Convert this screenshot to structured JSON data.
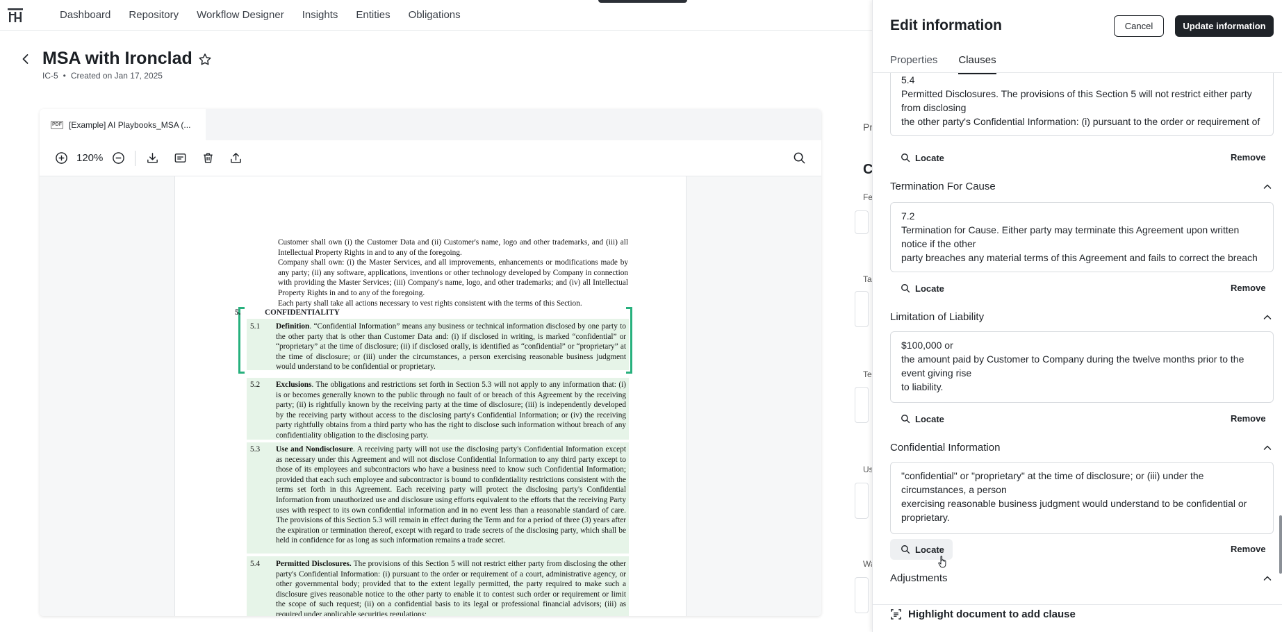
{
  "nav": {
    "items": [
      "Dashboard",
      "Repository",
      "Workflow Designer",
      "Insights",
      "Entities",
      "Obligations"
    ]
  },
  "document": {
    "title": "MSA with Ironclad",
    "id": "IC-5",
    "created": "Created on Jan 17, 2025",
    "tab_label": "[Example] AI Playbooks_MSA (...",
    "tab_badge": "PDF",
    "zoom": "120%"
  },
  "pdf": {
    "intro_lines": [
      "Customer shall own (i) the Customer Data and (ii) Customer's name, logo and other trademarks, and (iii) all Intellectual Property Rights in and to any of the foregoing.",
      "Company shall own: (i) the Master Services, and all improvements, enhancements or modifications made by any party; (ii) any software, applications, inventions or other technology developed by Company in connection with providing the Master Services; (iii) Company's name, logo, and other trademarks; and (iv) all Intellectual Property Rights in and to any of the foregoing.",
      "Each party shall take all actions necessary to vest rights consistent with the terms of this Section."
    ],
    "section_number": "5.",
    "section_title": "CONFIDENTIALITY",
    "clauses": [
      {
        "num": "5.1",
        "title": "Definition",
        "text": ". “Confidential Information” means any business or technical information disclosed by one party to the other party that is other than Customer Data and: (i) if disclosed in writing, is marked “confidential” or “proprietary” at the time of disclosure; (ii) if disclosed orally, is identified as “confidential” or “proprietary” at the time of disclosure; or (iii) under the circumstances, a person exercising reasonable business judgment would understand to be confidential or proprietary."
      },
      {
        "num": "5.2",
        "title": "Exclusions",
        "text": ".  The obligations and restrictions set forth in Section 5.3 will not apply to any information that: (i) is or becomes generally known to the public through no fault of or breach of this Agreement by the receiving party; (ii) is rightfully known by the receiving party at the time of disclosure; (iii) is independently developed by the receiving party without access to the disclosing party's Confidential Information; or (iv) the receiving party rightfully obtains from a third party who has the right to disclose such information without breach of any confidentiality obligation to the disclosing party."
      },
      {
        "num": "5.3",
        "title": "Use and Nondisclosure",
        "text": ".  A receiving party will not use the disclosing party's Confidential Information except as necessary under this Agreement and will not disclose Confidential Information to any third party except to those of its employees and subcontractors who have a business need to know such Confidential Information; provided that each such employee and subcontractor is bound to confidentiality restrictions consistent with the terms set forth in this Agreement.  Each receiving party will protect the disclosing party's Confidential Information from unauthorized use and disclosure using efforts equivalent to the efforts that the receiving Party uses with respect to its own confidential information and in no event less than a reasonable standard of care.  The provisions of this Section 5.3 will remain in effect during the Term and for a period of three (3) years after the expiration or termination thereof, except with regard to trade secrets of the disclosing party, which shall be held in confidence for as long as such information remains a trade secret."
      },
      {
        "num": "5.4",
        "title": "Permitted Disclosures.",
        "text": "  The provisions of this Section 5 will not restrict either party from disclosing the other party's Confidential Information: (i) pursuant to the order or requirement of a court, administrative agency, or other governmental body; provided that to the extent legally permitted, the party required to make such a disclosure gives reasonable notice to the other party to enable it to contest such order or requirement or limit the scope of such request; (ii) on a confidential basis to its legal or professional financial advisors; (iii) as required under applicable securities regulations;"
      }
    ]
  },
  "side_strip": {
    "letters": [
      "Pr",
      "C",
      "Fe",
      "Ta",
      "Te",
      "Us",
      "Wa"
    ]
  },
  "panel": {
    "title": "Edit information",
    "cancel": "Cancel",
    "update": "Update information",
    "tabs": [
      "Properties",
      "Clauses"
    ],
    "locate_label": "Locate",
    "remove_label": "Remove",
    "clauses": [
      {
        "name": "",
        "lines": [
          "5.4",
          "Permitted Disclosures. The provisions of this Section 5 will not restrict either party from disclosing",
          "the other party's Confidential Information: (i) pursuant to the order or requirement of"
        ]
      },
      {
        "name": "Termination For Cause",
        "lines": [
          "7.2",
          "Termination for Cause. Either party may terminate this Agreement upon written notice if the other",
          "party breaches any material terms of this Agreement and fails to correct the breach"
        ]
      },
      {
        "name": "Limitation of Liability",
        "lines": [
          "$100,000 or",
          "the amount paid by Customer to Company during the twelve months prior to the event giving rise",
          "to liability."
        ]
      },
      {
        "name": "Confidential Information",
        "lines": [
          "\"confidential\" or \"proprietary\" at the time of disclosure; or (iii) under the circumstances, a person",
          "exercising reasonable business judgment would understand to be confidential or proprietary."
        ]
      },
      {
        "name": "Adjustments",
        "lines": []
      }
    ],
    "footer_action": "Highlight document to add clause"
  },
  "colors": {
    "highlight": "#e6f4e8",
    "bracket": "#27b07d",
    "primary_button": "#1f2328"
  }
}
